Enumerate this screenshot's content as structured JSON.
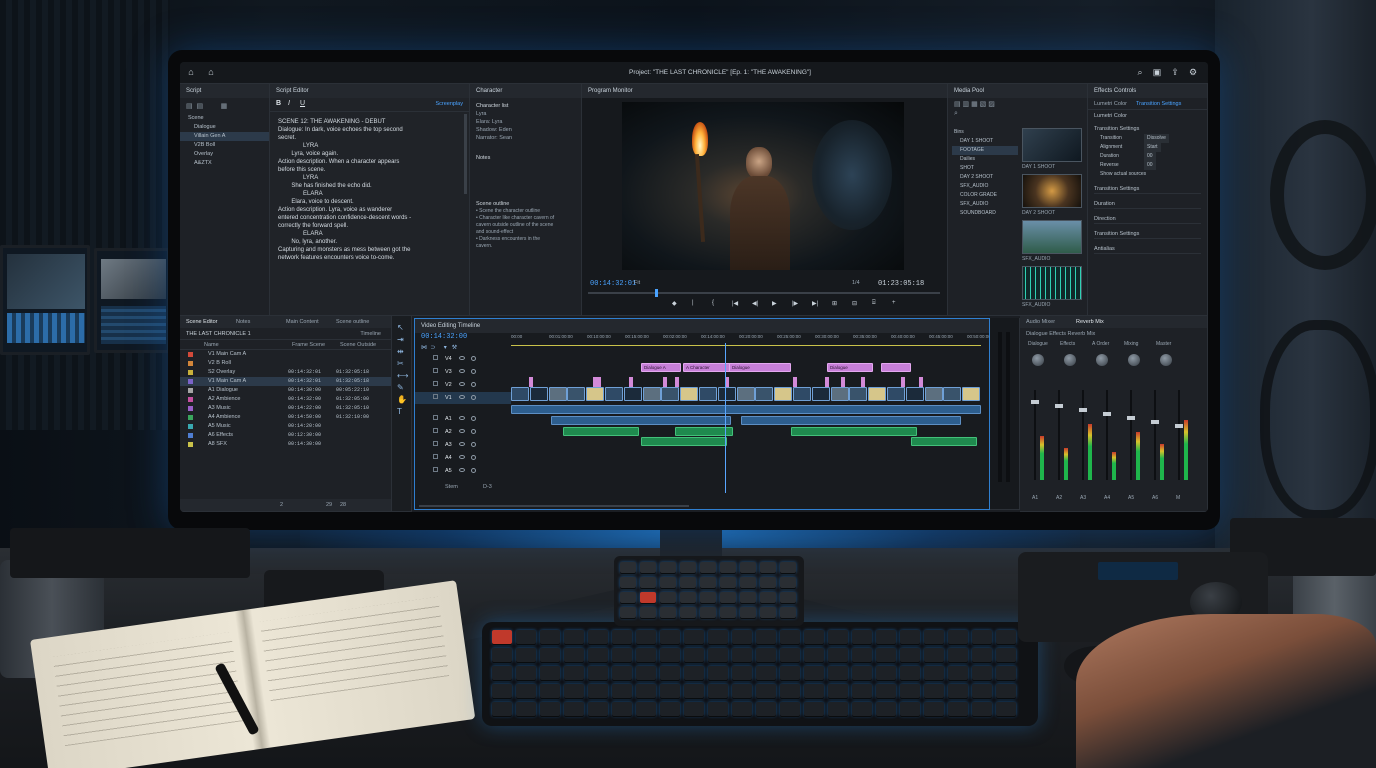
{
  "app": {
    "window_title": "Project: \"THE LAST CHRONICLE\" [Ep. 1: \"THE AWAKENING\"]"
  },
  "script_panel": {
    "title": "Script",
    "items": [
      "Scene",
      "Dialogue",
      "Villain Gen A",
      "V2B Boll",
      "Overlay",
      "A&ZTX"
    ]
  },
  "script_editor": {
    "title": "Script Editor",
    "toolbar": [
      "B",
      "I",
      "U"
    ],
    "mode_label": "Screenplay",
    "lines": [
      "SCENE 12: THE AWAKENING - DEBUT",
      "",
      "Dialogue: In dark, voice echoes the top second",
      "secret.",
      "",
      "               LYRA",
      "        Lyra, voice again.",
      "",
      "Action description. When a character appears",
      "before this scene.",
      "",
      "               LYRA",
      "        She has finished the echo did.",
      "",
      "               ELARA",
      "        Elara, voice to descent.",
      "",
      "Action description. Lyra, voice as wanderer",
      "entered concentration confidence-descent words -",
      "correctly the forward spell.",
      "",
      "               ELARA",
      "        No, lyra, another.",
      "",
      "Capturing and monsters as mess between got the",
      "network features encounters voice to-come."
    ]
  },
  "character_panel": {
    "title": "Character",
    "section": "Character list",
    "entries": [
      "Lyra",
      "Elara: Lyra",
      "Shadow: Eden",
      "Narrator: Sean"
    ],
    "notes_label": "Notes",
    "outline_title": "Scene outline",
    "outline_lines": [
      "• Scene the character outline",
      "• Character like character cavern of",
      "  cavern outside outline of the scene",
      "  and sound-effect",
      "• Darkness encounters in the",
      "  cavern."
    ]
  },
  "program_monitor": {
    "title": "Program Monitor",
    "timecode_current": "00:14:32:01",
    "timecode_total": "01:23:05:18",
    "fit_label": "Fit",
    "zoom_label": "1/4",
    "playhead_fraction": 0.19,
    "transport": [
      "◆",
      "|",
      "{",
      "|◀",
      "◀|",
      "▶",
      "|▶",
      "▶|",
      "⊞",
      "⊟",
      "⌸",
      "+"
    ]
  },
  "media_pool": {
    "title": "Media Pool",
    "folders": [
      "Bins",
      "DAY 1 SHOOT",
      "FOOTAGE",
      "Dailies",
      "SHOT",
      "DAY 2 SHOOT",
      "SFX_AUDIO",
      "COLOR GRADE",
      "SFX_AUDIO",
      "SOUNDBOARD"
    ],
    "thumbs": [
      "DAY 1 SHOOT",
      "DAY 2 SHOOT",
      "SFX_AUDIO",
      "SFX_AUDIO"
    ]
  },
  "effects_controls": {
    "title": "Effects Controls",
    "tabs": [
      "Lumetri Color",
      "Transition Settings"
    ],
    "sections": [
      "Lumetri Color",
      "Transition Settings",
      "Transition Settings",
      "Duration",
      "Direction",
      "Transition Settings",
      "Antialias"
    ],
    "params": [
      {
        "label": "Transition",
        "value": "Dissolve"
      },
      {
        "label": "Alignment",
        "value": "Start"
      },
      {
        "label": "Duration",
        "value": "00"
      },
      {
        "label": "Reverse",
        "value": "00"
      }
    ],
    "checkbox_label": "Show actual sources"
  },
  "scene_list": {
    "tabs": [
      "Scene Editor",
      "Notes",
      "Main Content",
      "Scene outline"
    ],
    "project_label": "THE LAST CHRONICLE 1",
    "header_right": "Timeline",
    "columns": [
      "Name",
      "Frame Scene",
      "Scene Outside"
    ],
    "rows": [
      {
        "color": "#d24a3a",
        "name": "V1 Main Cam A",
        "a": "",
        "b": ""
      },
      {
        "color": "#d2863a",
        "name": "V2 B Roll",
        "a": "",
        "b": ""
      },
      {
        "color": "#c9b13b",
        "name": "S2 Overlay",
        "a": "00:14:32:01",
        "b": "01:32:05:18"
      },
      {
        "color": "#7b63c9",
        "name": "V1 Main Cam A",
        "a": "00:14:32:01",
        "b": "01:32:05:18"
      },
      {
        "color": "#a5a5a5",
        "name": "A1 Dialogue",
        "a": "00:14:30:00",
        "b": "00:05:22:10"
      },
      {
        "color": "#c74fa1",
        "name": "A2 Ambience",
        "a": "00:14:32:00",
        "b": "01:32:05:00"
      },
      {
        "color": "#9a5fc8",
        "name": "A3 Music",
        "a": "00:14:22:00",
        "b": "01:32:05:10"
      },
      {
        "color": "#3aa65d",
        "name": "A4 Ambience",
        "a": "00:14:50:00",
        "b": "01:32:10:00"
      },
      {
        "color": "#39a9b1",
        "name": "A5 Music",
        "a": "00:14:20:00",
        "b": ""
      },
      {
        "color": "#4f7ed2",
        "name": "A6 Effects",
        "a": "00:12:30:00",
        "b": ""
      },
      {
        "color": "#c9c24a",
        "name": "A8 SFX",
        "a": "00:14:30:00",
        "b": ""
      }
    ],
    "footer": [
      "2",
      "29",
      "28"
    ]
  },
  "timeline": {
    "title": "Video Editing Timeline",
    "timecode": "00:14:32:00",
    "ruler": [
      "00:00",
      "00:01:00:00",
      "00:10:00:00",
      "00:15:00:00",
      "00:02:00:00",
      "00:14:00:00",
      "00:20:00:00",
      "00:25:00:00",
      "00:30:00:00",
      "00:35:00:00",
      "00:40:00:00",
      "00:45:00:00",
      "00:50:00:00"
    ],
    "track_labels": [
      "V4",
      "V3",
      "V2",
      "V1",
      "A1",
      "A2",
      "A3",
      "A4",
      "A5"
    ],
    "marker_labels": [
      "Dialogue A",
      "A Character",
      "Dialogue",
      "Dialogue",
      ""
    ],
    "footer_labels": [
      "Stem",
      "D-3"
    ]
  },
  "audio_mixer": {
    "tabs": [
      "Audio Mixer",
      "Reverb Mix"
    ],
    "subtitle": "Dialogue Effects Reverb Mix",
    "channel_labels": [
      "Dialogue",
      "Effects",
      "A Order",
      "Mixing",
      "Master"
    ],
    "channel_levels": [
      0.55,
      0.4,
      0.7,
      0.35,
      0.6,
      0.45,
      0.75
    ],
    "bottom_labels": [
      "A1",
      "A2",
      "A3",
      "A4",
      "A5",
      "A6",
      "M"
    ]
  },
  "colors": {
    "accent": "#2f8de4",
    "video_clip": "#3a6aa0",
    "audio_green": "#1f8a4e",
    "marker_pink": "#c77fd8",
    "playhead": "#58a6ff"
  }
}
